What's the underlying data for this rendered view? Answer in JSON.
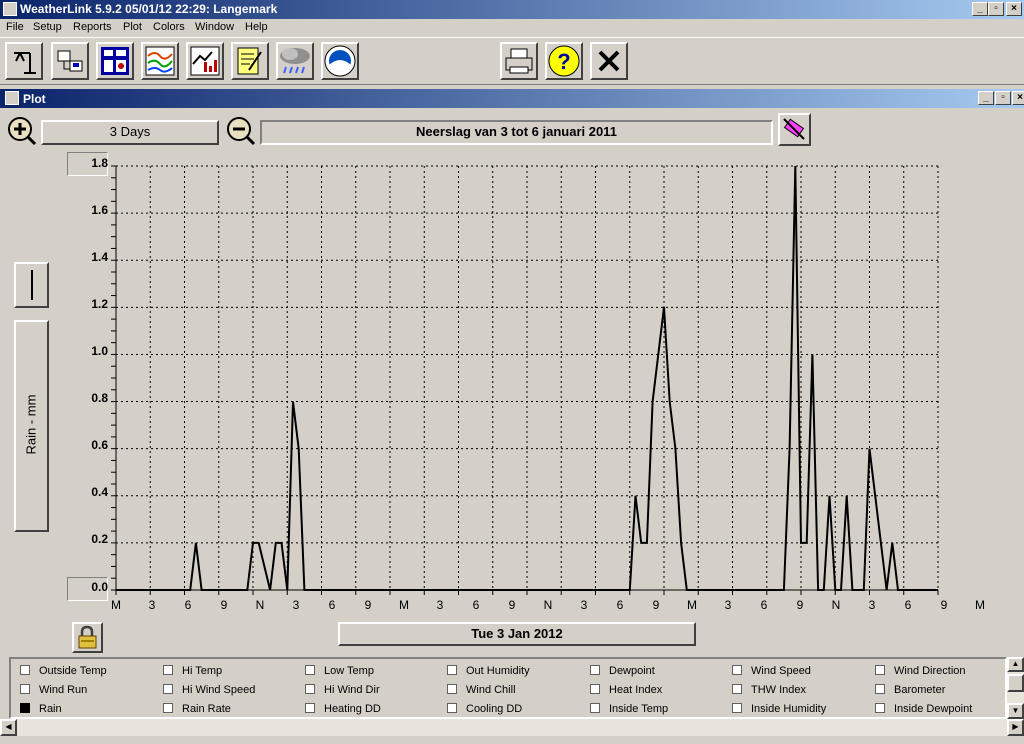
{
  "window": {
    "title": "WeatherLink 5.9.2  05/01/12  22:29: Langemark"
  },
  "menu": [
    "File",
    "Setup",
    "Reports",
    "Plot",
    "Colors",
    "Window",
    "Help"
  ],
  "toolbar": {
    "buttons": [
      "station-icon",
      "download-icon",
      "bulletin-icon",
      "strip-chart-icon",
      "plot-icon",
      "notes-icon",
      "rain-cloud-icon",
      "noaa-icon"
    ],
    "right_buttons": [
      "printer-icon",
      "help-icon",
      "close-icon"
    ]
  },
  "plot_window": {
    "title": "Plot",
    "span_label": "3 Days",
    "plot_title": "Neerslag van 3 tot 6 januari 2011",
    "date_label": "Tue 3 Jan 2012",
    "y_axis_label": "Rain - mm"
  },
  "chart_data": {
    "type": "line",
    "ylabel": "Rain - mm",
    "ylim": [
      0,
      1.8
    ],
    "y_ticks": [
      "1.8",
      "1.6",
      "1.4",
      "1.2",
      "1.0",
      "0.8",
      "0.6",
      "0.4",
      "0.2",
      "0.0"
    ],
    "x_ticks": [
      "M",
      "3",
      "6",
      "9",
      "N",
      "3",
      "6",
      "9",
      "M",
      "3",
      "6",
      "9",
      "N",
      "3",
      "6",
      "9",
      "M",
      "3",
      "6",
      "9",
      "N",
      "3",
      "6",
      "9",
      "M"
    ],
    "x_range_hours": [
      0,
      72
    ],
    "grid": true,
    "series": [
      {
        "x": [
          0,
          6.5,
          7,
          7.5,
          11.5,
          12,
          12.5,
          13.5,
          14,
          14.5,
          15,
          15.5,
          16,
          16.5,
          17,
          17.5,
          45,
          45.5,
          46,
          46.5,
          47,
          47.5,
          48,
          48.5,
          49,
          49.5,
          50,
          50.5,
          51,
          58.5,
          59,
          59.5,
          60,
          60.5,
          61,
          61.5,
          62,
          62.5,
          63,
          63.5,
          64,
          64.5,
          65,
          65.5,
          66,
          67.5,
          68,
          68.5,
          69,
          69.5,
          72
        ],
        "values": [
          0,
          0,
          0.2,
          0,
          0,
          0.2,
          0.2,
          0,
          0.2,
          0.2,
          0,
          0.8,
          0.6,
          0,
          0,
          0,
          0,
          0.4,
          0.2,
          0.2,
          0.8,
          1.0,
          1.2,
          0.8,
          0.6,
          0.2,
          0,
          0,
          0,
          0,
          0.6,
          1.8,
          0.2,
          0.2,
          1.0,
          0,
          0,
          0.4,
          0,
          0,
          0.4,
          0,
          0,
          0,
          0.6,
          0,
          0.2,
          0,
          0,
          0,
          0
        ]
      }
    ]
  },
  "legend": [
    [
      "Outside Temp",
      "Hi Temp",
      "Low Temp",
      "Out Humidity",
      "Dewpoint",
      "Wind Speed",
      "Wind Direction"
    ],
    [
      "Wind Run",
      "Hi Wind Speed",
      "Hi Wind Dir",
      "Wind Chill",
      "Heat Index",
      "THW Index",
      "Barometer"
    ],
    [
      "Rain",
      "Rain Rate",
      "Heating DD",
      "Cooling DD",
      "Inside Temp",
      "Inside Humidity",
      "Inside Dewpoint"
    ]
  ],
  "legend_checked": [
    "Rain"
  ]
}
